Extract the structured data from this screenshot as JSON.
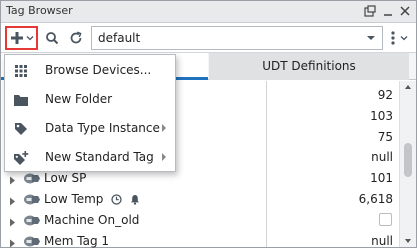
{
  "window": {
    "title": "Tag Browser"
  },
  "toolbar": {
    "provider_value": "default",
    "add_icon": "plus-icon",
    "search_icon": "search-icon",
    "refresh_icon": "refresh-icon",
    "more_icon": "more-vertical-icon"
  },
  "tabs": {
    "udt_label": "UDT Definitions"
  },
  "add_menu": {
    "items": [
      {
        "label": "Browse Devices...",
        "icon": "devices-icon",
        "has_submenu": false
      },
      {
        "label": "New Folder",
        "icon": "folder-icon",
        "has_submenu": false
      },
      {
        "label": "Data Type Instance",
        "icon": "tag-icon",
        "has_submenu": true
      },
      {
        "label": "New Standard Tag",
        "icon": "new-tag-icon",
        "has_submenu": true
      }
    ]
  },
  "tree": {
    "rows": [
      {
        "name": "",
        "value": "92"
      },
      {
        "name": "",
        "value": "103"
      },
      {
        "name": "",
        "value": "75"
      },
      {
        "name": "",
        "value": "null"
      },
      {
        "name": "Low SP",
        "value": "101"
      },
      {
        "name": "Low Temp",
        "value": "6,618"
      },
      {
        "name": "Machine On_old",
        "value": "",
        "checkbox": true
      },
      {
        "name": "Mem Tag 1",
        "value": "null"
      }
    ]
  },
  "colors": {
    "accent": "#1e73be",
    "highlight_border": "#e53935",
    "icon_gray": "#4a5560"
  }
}
